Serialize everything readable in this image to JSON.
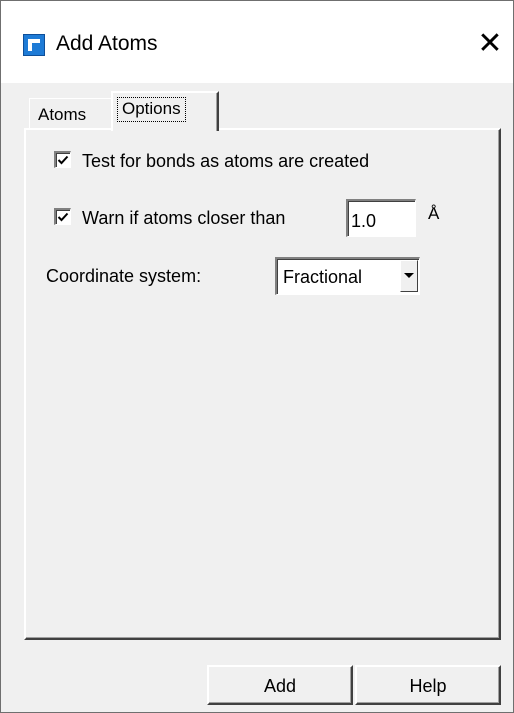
{
  "window": {
    "title": "Add Atoms",
    "close_glyph": "✕",
    "app_icon": "app-icon"
  },
  "tabs": [
    {
      "label": "Atoms",
      "selected": false
    },
    {
      "label": "Options",
      "selected": true
    }
  ],
  "options": {
    "test_bonds": {
      "label": "Test for bonds as atoms are created",
      "checked": true
    },
    "warn_closer": {
      "label": "Warn if atoms closer than",
      "checked": true,
      "value": "1.0",
      "unit": "Å"
    },
    "coordinate_system": {
      "label": "Coordinate system:",
      "selected": "Fractional"
    }
  },
  "buttons": {
    "add": "Add",
    "help": "Help"
  },
  "colors": {
    "background": "#f0f0f0",
    "titlebar": "#ffffff",
    "icon_blue": "#1e7bd6"
  }
}
